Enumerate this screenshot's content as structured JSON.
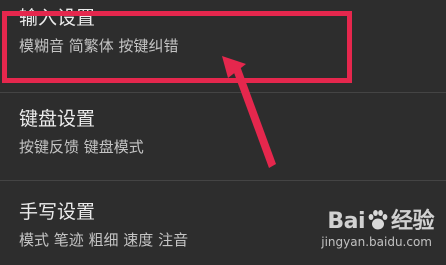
{
  "settings": {
    "items": [
      {
        "title": "输入设置",
        "subtitle": "模糊音 简繁体 按键纠错"
      },
      {
        "title": "键盘设置",
        "subtitle": "按键反馈 键盘模式"
      },
      {
        "title": "手写设置",
        "subtitle": "模式 笔迹 粗细 速度 注音"
      }
    ]
  },
  "annotation": {
    "highlight_color": "#e5274d",
    "arrow_color": "#e5274d",
    "highlighted_item": "输入设置"
  },
  "watermark": {
    "logo_left": "Bai",
    "logo_right": "经验",
    "url": "jingyan.baidu.com",
    "icon": "paw-icon"
  },
  "colors": {
    "background": "#2d2d2d",
    "title_text": "#ececec",
    "subtitle_text": "#c4c4c4"
  }
}
